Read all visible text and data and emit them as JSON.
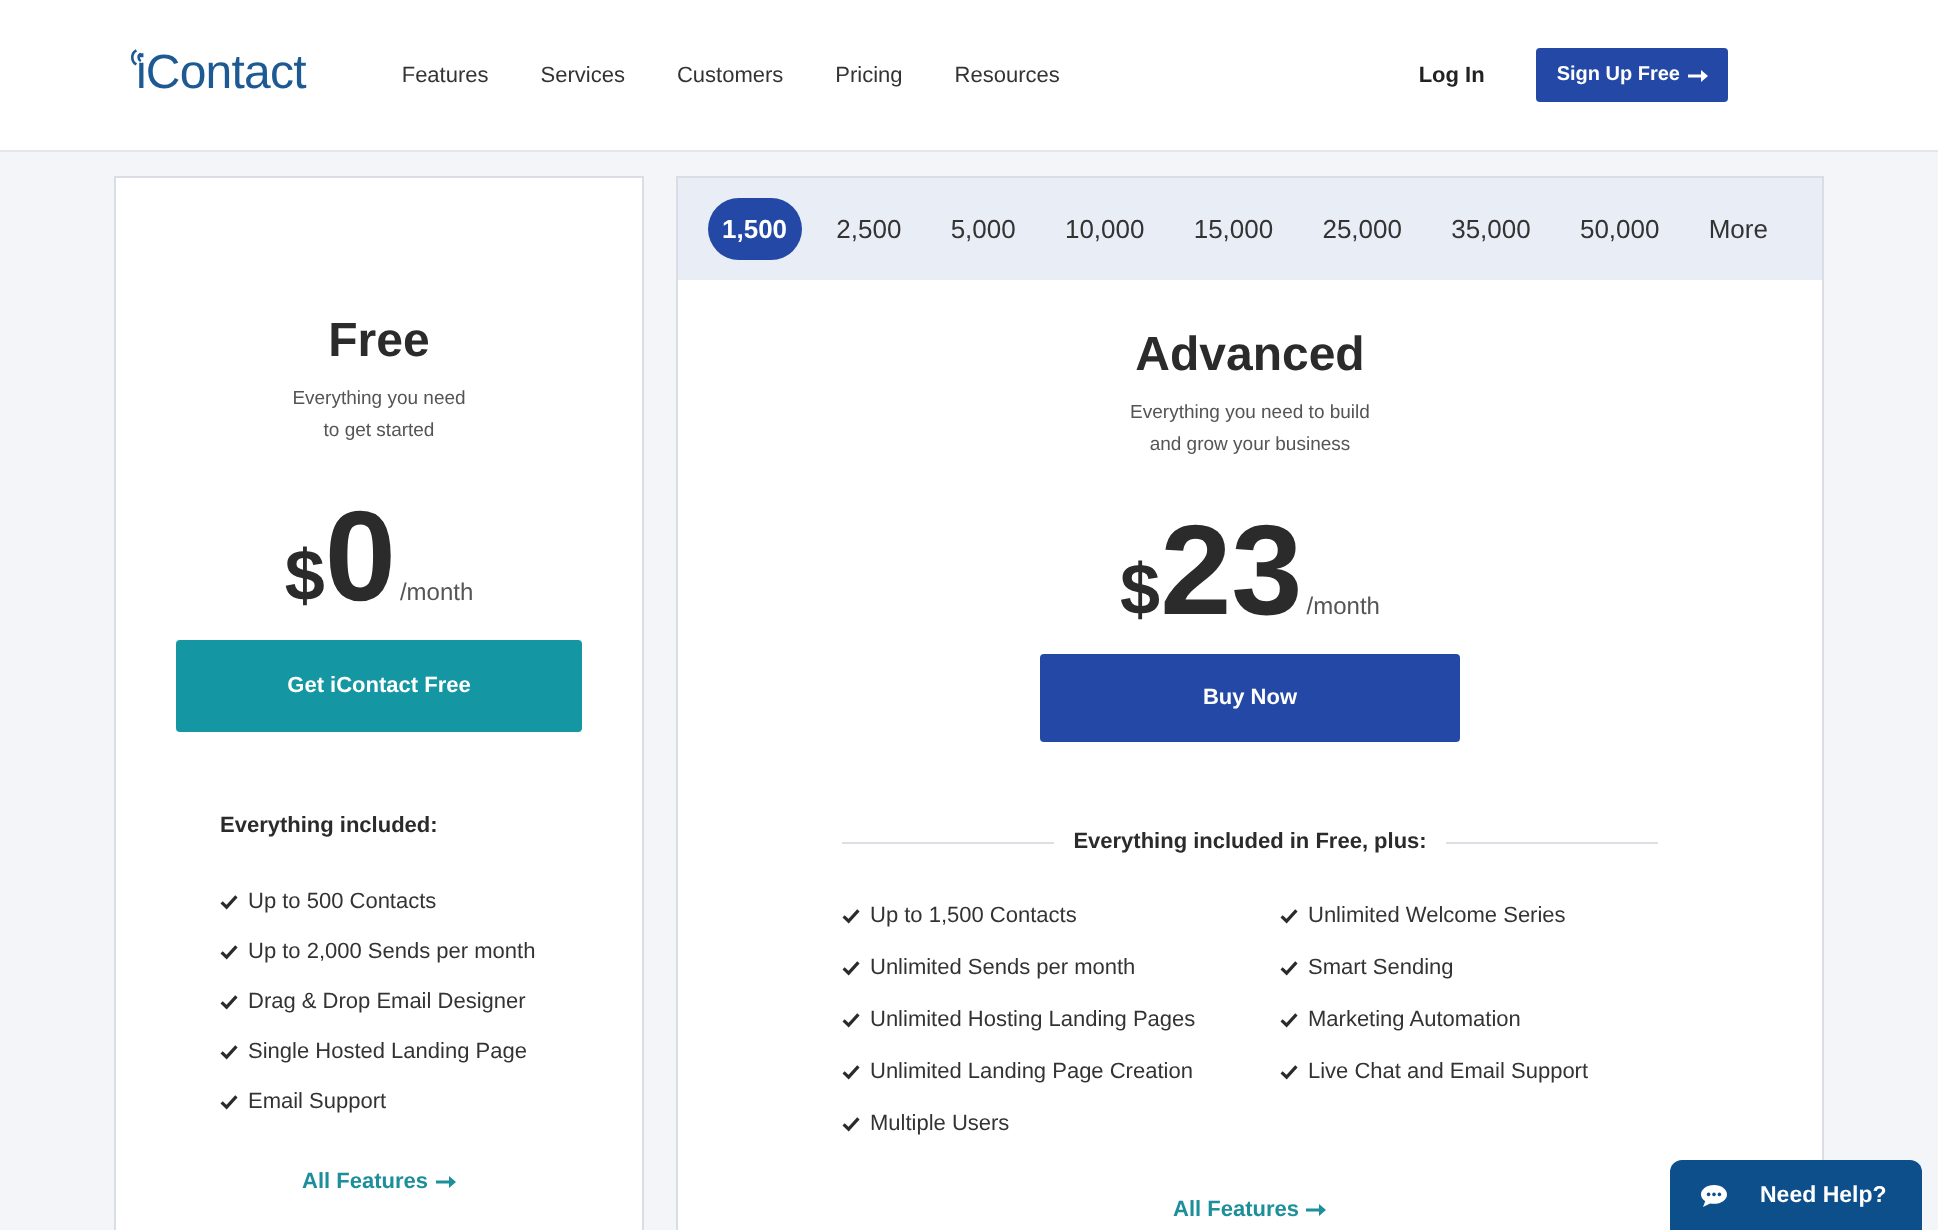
{
  "header": {
    "logo": "iContact",
    "nav": [
      "Features",
      "Services",
      "Customers",
      "Pricing",
      "Resources"
    ],
    "login": "Log In",
    "signup": "Sign Up Free"
  },
  "plans": [
    {
      "kind": "basic",
      "name": "Free",
      "description": [
        "Everything you need",
        "to get started"
      ],
      "currency": "$",
      "price": "0",
      "period": "/month",
      "cta": "Get iContact Free",
      "features_title": "Everything included:",
      "features": [
        "Up to 500 Contacts",
        "Up to 2,000 Sends per month",
        "Drag & Drop Email Designer",
        "Single Hosted Landing Page",
        "Email Support"
      ],
      "link": "All Features"
    },
    {
      "kind": "tiered",
      "tiers": [
        {
          "label": "1,500",
          "selected": true
        },
        {
          "label": "2,500",
          "selected": false
        },
        {
          "label": "5,000",
          "selected": false
        },
        {
          "label": "10,000",
          "selected": false
        },
        {
          "label": "15,000",
          "selected": false
        },
        {
          "label": "25,000",
          "selected": false
        },
        {
          "label": "35,000",
          "selected": false
        },
        {
          "label": "50,000",
          "selected": false
        },
        {
          "label": "More",
          "selected": false
        }
      ],
      "name": "Advanced",
      "description": [
        "Everything you need to build",
        "and grow your business"
      ],
      "currency": "$",
      "price": "23",
      "period": "/month",
      "cta": "Buy Now",
      "features_title": "Everything included in Free, plus:",
      "features": [
        "Up to 1,500 Contacts",
        "Unlimited Sends per month",
        "Unlimited Hosting Landing Pages",
        "Unlimited Landing Page Creation",
        "Multiple Users",
        "Unlimited Welcome Series",
        "Smart Sending",
        "Marketing Automation",
        "Live Chat and Email Support"
      ],
      "link": "All Features"
    }
  ],
  "help_button": "Need Help?"
}
